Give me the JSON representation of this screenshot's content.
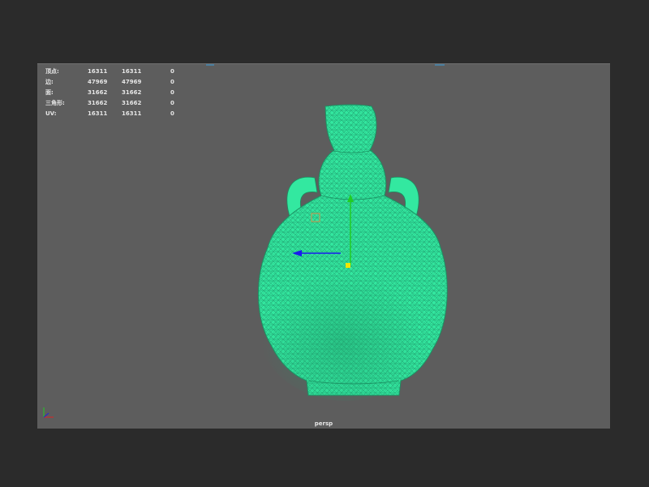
{
  "viewport": {
    "camera_label": "persp",
    "background_color": "#5d5d5d",
    "wire_color": "#33e8a0",
    "stats": [
      {
        "label": "顶点:",
        "values": [
          "16311",
          "16311",
          "0"
        ]
      },
      {
        "label": "边:",
        "values": [
          "47969",
          "47969",
          "0"
        ]
      },
      {
        "label": "面:",
        "values": [
          "31662",
          "31662",
          "0"
        ]
      },
      {
        "label": "三角形:",
        "values": [
          "31662",
          "31662",
          "0"
        ]
      },
      {
        "label": "UV:",
        "values": [
          "16311",
          "16311",
          "0"
        ]
      }
    ]
  },
  "manipulator": {
    "y_axis_color": "#22cc22",
    "x_axis_color": "#1a1aee",
    "pivot_color": "#f2e600"
  },
  "axis_indicator": {
    "x_color": "#dd2222",
    "y_color": "#22cc22",
    "z_color": "#2222dd"
  }
}
